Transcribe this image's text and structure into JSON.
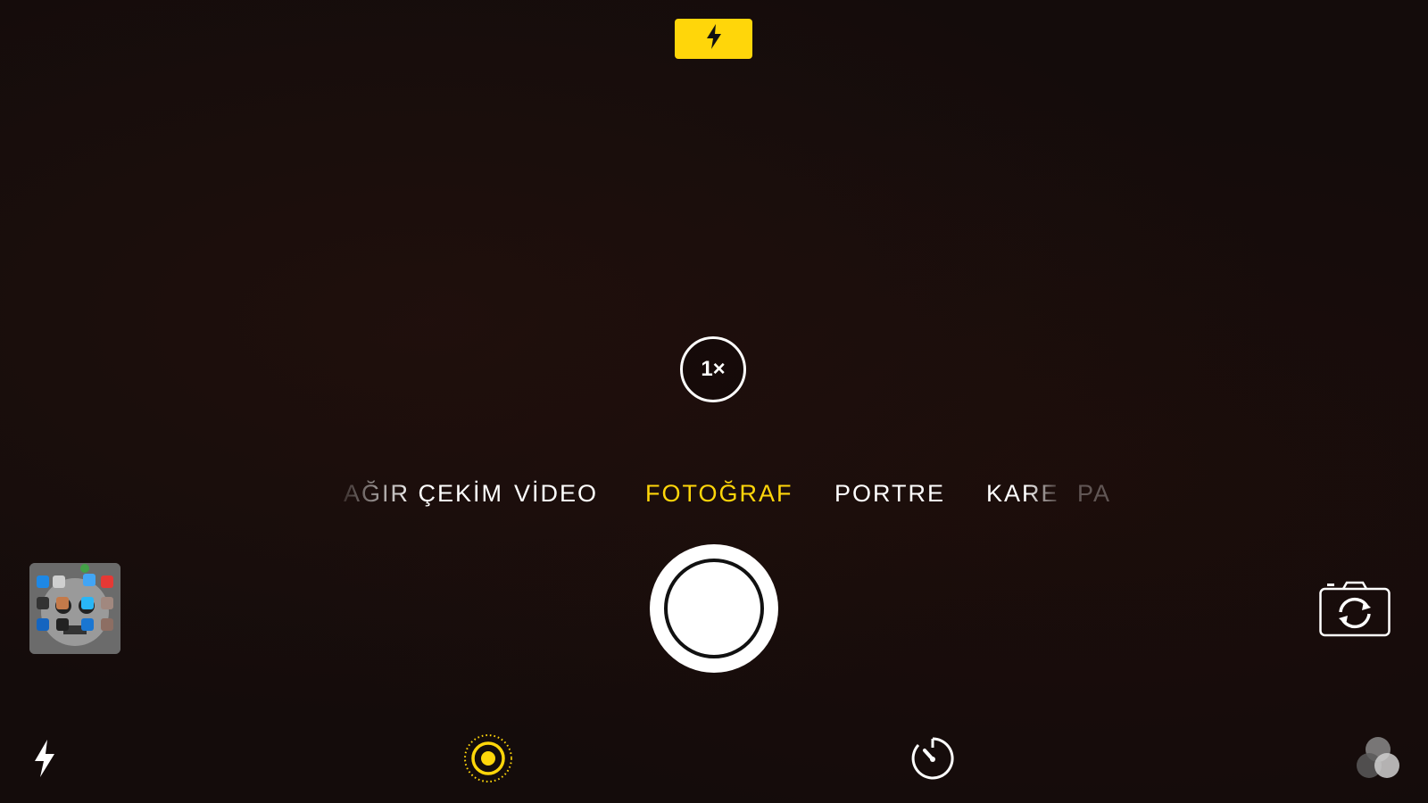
{
  "top_bar": {
    "flash_indicator_icon": "flash-icon",
    "flash_color": "#ffd60a"
  },
  "zoom": {
    "label": "1×"
  },
  "modes": [
    {
      "label": "AĞIR ÇEKİM"
    },
    {
      "label": "VİDEO"
    },
    {
      "label": "FOTOĞRAF",
      "active": true
    },
    {
      "label": "PORTRE"
    },
    {
      "label": "KARE"
    },
    {
      "label": "PA"
    }
  ],
  "bottom_bar": {
    "flash_toggle_icon": "flash-icon",
    "live_photo_icon": "live-photo-icon",
    "timer_icon": "timer-icon",
    "filters_icon": "filters-icon"
  },
  "shutter": {
    "icon": "shutter-button"
  },
  "thumbnail": {
    "icon": "last-photo-thumbnail"
  },
  "camera_switch": {
    "icon": "camera-flip-icon"
  },
  "colors": {
    "accent": "#ffd60a",
    "text": "#ffffff",
    "background": "#140c0b"
  }
}
